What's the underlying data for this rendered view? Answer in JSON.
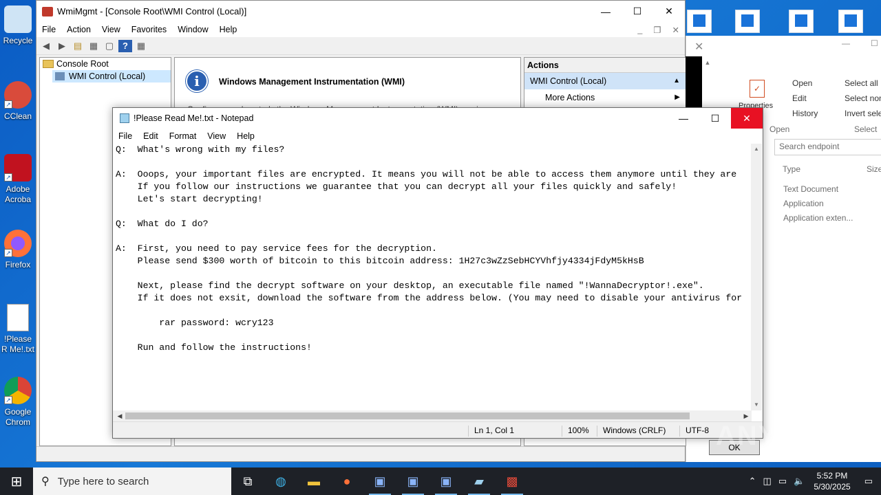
{
  "desktop": {
    "icons": [
      {
        "label": "Recycle",
        "color": "#5aa0d8"
      },
      {
        "label": "CClean",
        "color": "#d94b3b"
      },
      {
        "label": "Adobe Acroba",
        "color": "#c1121f"
      },
      {
        "label": "Firefox",
        "color": "#ff7139"
      },
      {
        "label": "!Please R Me!.txt",
        "color": "#ffffff"
      },
      {
        "label": "Google Chrom",
        "color": "#2e8b57"
      }
    ]
  },
  "mmc": {
    "title": "WmiMgmt - [Console Root\\WMI Control (Local)]",
    "menu": [
      "File",
      "Action",
      "View",
      "Favorites",
      "Window",
      "Help"
    ],
    "tree": {
      "root": "Console Root",
      "child": "WMI Control (Local)"
    },
    "main": {
      "title": "Windows Management Instrumentation (WMI)",
      "desc": "Configures and controls the Windows Management Instrumentation (WMI) service."
    },
    "actions": {
      "header": "Actions",
      "group": "WMI Control (Local)",
      "more": "More Actions"
    }
  },
  "explorer": {
    "open_btn": "Open",
    "edit_btn": "Edit",
    "history_btn": "History",
    "properties_btn": "Properties",
    "open_group": "Open",
    "select_all": "Select all",
    "select_none": "Select non",
    "invert_select": "Invert selec",
    "select_group": "Select",
    "search_placeholder": "Search endpoint",
    "col_type": "Type",
    "col_size": "Size",
    "types": [
      "Text Document",
      "Application",
      "Application exten..."
    ]
  },
  "notepad": {
    "title": "!Please Read Me!.txt - Notepad",
    "menu": [
      "File",
      "Edit",
      "Format",
      "View",
      "Help"
    ],
    "content": "Q:  What's wrong with my files?\n\nA:  Ooops, your important files are encrypted. It means you will not be able to access them anymore until they are\n    If you follow our instructions we guarantee that you can decrypt all your files quickly and safely!\n    Let's start decrypting!\n\nQ:  What do I do?\n\nA:  First, you need to pay service fees for the decryption.\n    Please send $300 worth of bitcoin to this bitcoin address: 1H27c3wZzSebHCYVhfjy4334jFdyM5kHsB\n\n    Next, please find the decrypt software on your desktop, an executable file named \"!WannaDecryptor!.exe\".\n    If it does not exsit, download the software from the address below. (You may need to disable your antivirus for\n\n        rar password: wcry123\n\n    Run and follow the instructions!",
    "status": {
      "position": "Ln 1, Col 1",
      "zoom": "100%",
      "eol": "Windows (CRLF)",
      "encoding": "UTF-8"
    }
  },
  "dialog": {
    "ok": "OK"
  },
  "watermark": "ANY RUN",
  "taskbar": {
    "search_placeholder": "Type here to search",
    "time": "5:52 PM",
    "date": "5/30/2025"
  }
}
